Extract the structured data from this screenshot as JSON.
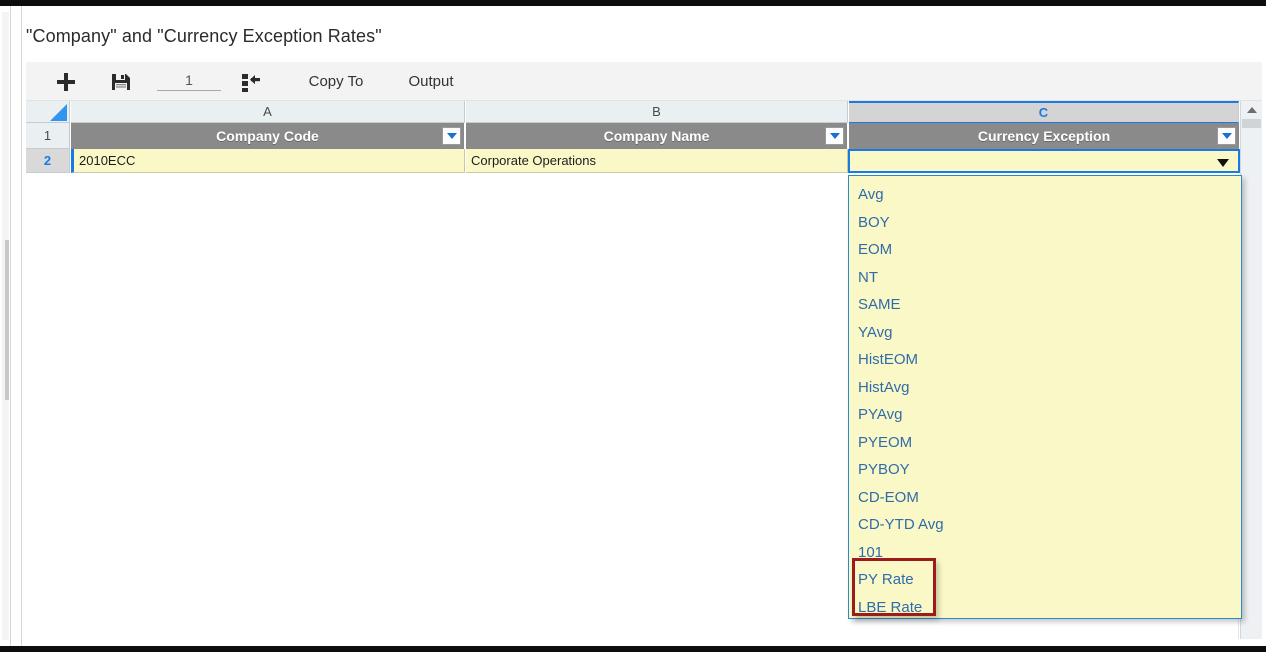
{
  "window": {
    "title": "\"Company\" and \"Currency Exception Rates\""
  },
  "toolbar": {
    "add_label": "+",
    "add_icon": "plus-icon",
    "save_icon": "save-floppy-icon",
    "row_count_value": "1",
    "row_count_placeholder": "1",
    "insert_rows_icon": "insert-rows-icon",
    "copy_to_label": "Copy To",
    "output_label": "Output"
  },
  "grid": {
    "select_all_icon": "select-all-triangle-icon",
    "column_letters": [
      "A",
      "B",
      "C"
    ],
    "selected_column": "C",
    "row_numbers": [
      "1",
      "2"
    ],
    "selected_row": "2",
    "headers": [
      {
        "letter": "A",
        "label": "Company Code"
      },
      {
        "letter": "B",
        "label": "Company Name"
      },
      {
        "letter": "C",
        "label": "Currency Exception"
      }
    ],
    "rows": [
      {
        "number": "2",
        "company_code": "2010ECC",
        "company_name": "Corporate Operations",
        "currency_exception": ""
      }
    ],
    "filter_icon": "filter-dropdown-icon",
    "cell_dropdown_icon": "chevron-down-icon",
    "scrollbar_up_icon": "scroll-up-arrow-icon"
  },
  "dropdown": {
    "open": true,
    "options": [
      "Avg",
      "BOY",
      "EOM",
      "NT",
      "SAME",
      "YAvg",
      "HistEOM",
      "HistAvg",
      "PYAvg",
      "PYEOM",
      "PYBOY",
      "CD-EOM",
      "CD-YTD Avg",
      "101",
      "PY Rate",
      "LBE Rate"
    ],
    "highlighted_options": [
      "PY Rate",
      "LBE Rate"
    ]
  },
  "colors": {
    "accent_blue": "#1a7ae4",
    "cell_yellow": "#fbf8c8",
    "header_gray": "#8a8a8a",
    "option_text_blue": "#2f6ca8",
    "annotation_red": "#9e1b1b"
  }
}
